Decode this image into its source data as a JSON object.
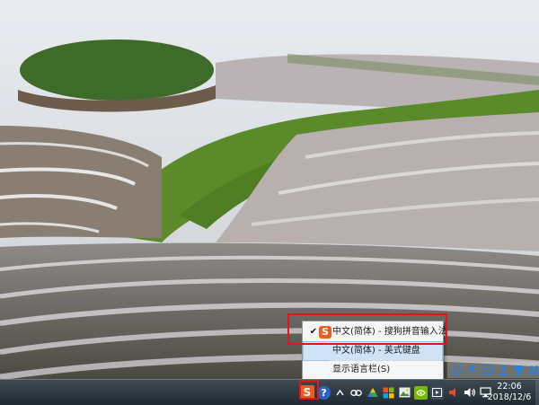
{
  "ime_menu": {
    "items": [
      {
        "label": "中文(简体) - 搜狗拼音输入法",
        "checked": true,
        "icon": "sogou-icon"
      },
      {
        "label": "中文(简体) - 美式键盘",
        "checked": false,
        "highlighted": true
      },
      {
        "label": "显示语言栏(S)",
        "checked": false
      }
    ],
    "check_glyph": "✔",
    "sogou_glyph": "S"
  },
  "tray": {
    "ime_glyph": "S",
    "help_glyph": "?"
  },
  "clock": {
    "time": "22:06",
    "date": "2018/12/6"
  },
  "colors": {
    "highlight_border": "#e5141a",
    "sogou_orange": "#f25a1e",
    "taskbar": "#27323a"
  }
}
